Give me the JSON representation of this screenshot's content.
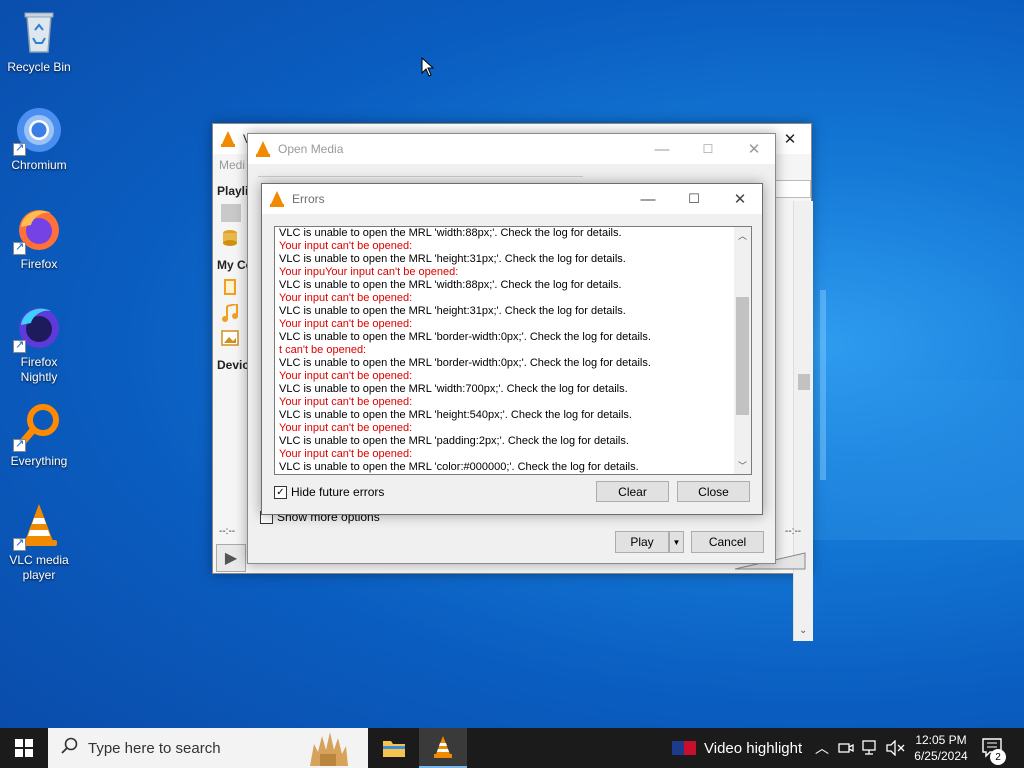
{
  "desktop": {
    "icons": [
      {
        "label": "Recycle Bin",
        "icon": "recycle-bin-icon"
      },
      {
        "label": "Chromium",
        "icon": "chromium-icon"
      },
      {
        "label": "Firefox",
        "icon": "firefox-icon"
      },
      {
        "label": "Firefox Nightly",
        "icon": "firefox-nightly-icon"
      },
      {
        "label": "Everything",
        "icon": "everything-search-icon"
      },
      {
        "label": "VLC media player",
        "icon": "vlc-icon"
      }
    ]
  },
  "vlc_main": {
    "title": "VL",
    "menu": "Medi",
    "sidebar": {
      "playlist": "Playli",
      "my_computer": "My Co",
      "devices": "Devic"
    },
    "time_left": "--:--",
    "time_right": "--:--"
  },
  "open_media": {
    "title": "Open Media",
    "show_more_options": "Show more options",
    "show_more_checked": false,
    "play_button": "Play",
    "cancel_button": "Cancel"
  },
  "errors": {
    "title": "Errors",
    "lines": [
      {
        "type": "msg",
        "text": "VLC is unable to open the MRL 'width:88px;'. Check the log for details."
      },
      {
        "type": "err",
        "text": "Your input can't be opened:"
      },
      {
        "type": "msg",
        "text": "VLC is unable to open the MRL 'height:31px;'. Check the log for details."
      },
      {
        "type": "err",
        "text": "Your inpuYour input can't be opened:"
      },
      {
        "type": "msg",
        "text": "VLC is unable to open the MRL 'width:88px;'. Check the log for details."
      },
      {
        "type": "err",
        "text": "Your input can't be opened:"
      },
      {
        "type": "msg",
        "text": "VLC is unable to open the MRL 'height:31px;'. Check the log for details."
      },
      {
        "type": "err",
        "text": "Your input can't be opened:"
      },
      {
        "type": "msg",
        "text": "VLC is unable to open the MRL 'border-width:0px;'. Check the log for details."
      },
      {
        "type": "err",
        "text": "t can't be opened:"
      },
      {
        "type": "msg",
        "text": "VLC is unable to open the MRL 'border-width:0px;'. Check the log for details."
      },
      {
        "type": "err",
        "text": "Your input can't be opened:"
      },
      {
        "type": "msg",
        "text": "VLC is unable to open the MRL 'width:700px;'. Check the log for details."
      },
      {
        "type": "err",
        "text": "Your input can't be opened:"
      },
      {
        "type": "msg",
        "text": "VLC is unable to open the MRL 'height:540px;'. Check the log for details."
      },
      {
        "type": "err",
        "text": "Your input can't be opened:"
      },
      {
        "type": "msg",
        "text": "VLC is unable to open the MRL 'padding:2px;'. Check the log for details."
      },
      {
        "type": "err",
        "text": "Your input can't be opened:"
      },
      {
        "type": "msg",
        "text": "VLC is unable to open the MRL 'color:#000000;'. Check the log for details."
      }
    ],
    "hide_future_errors_label": "Hide future errors",
    "hide_future_errors_checked": true,
    "clear_button": "Clear",
    "close_button": "Close"
  },
  "taskbar": {
    "search_placeholder": "Type here to search",
    "video_highlight": "Video highlight",
    "time": "12:05 PM",
    "date": "6/25/2024",
    "notification_count": "2"
  },
  "colors": {
    "error_red": "#e00000",
    "vlc_orange": "#f08a00",
    "taskbar_bg": "#1b1b1b"
  }
}
